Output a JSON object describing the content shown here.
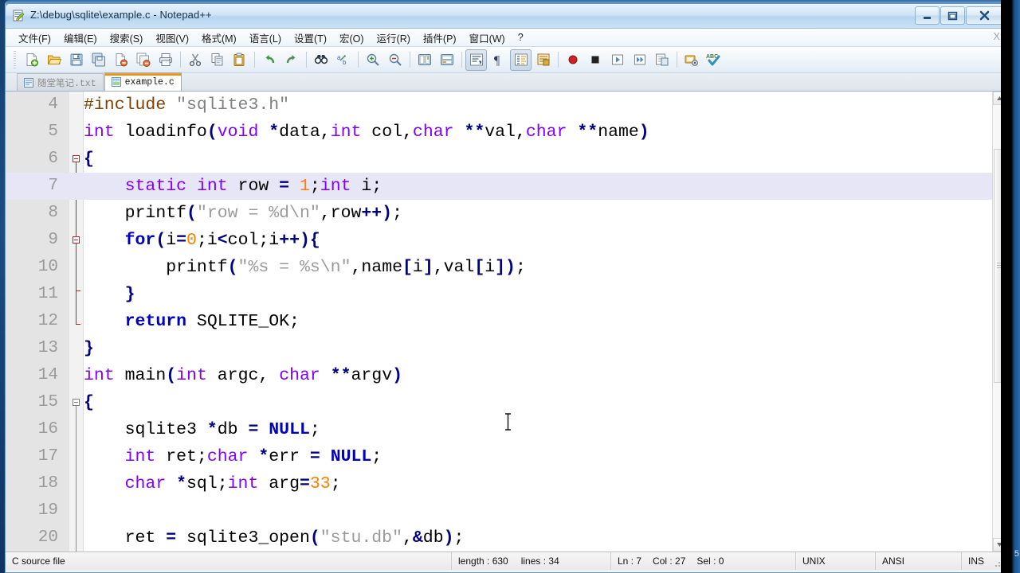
{
  "window": {
    "title": "Z:\\debug\\sqlite\\example.c - Notepad++",
    "minimize_label": "Minimize",
    "restore_label": "Restore",
    "close_label": "Close"
  },
  "menu": {
    "items": [
      {
        "label": "文件(F)",
        "name": "menu-file"
      },
      {
        "label": "编辑(E)",
        "name": "menu-edit"
      },
      {
        "label": "搜索(S)",
        "name": "menu-search"
      },
      {
        "label": "视图(V)",
        "name": "menu-view"
      },
      {
        "label": "格式(M)",
        "name": "menu-format"
      },
      {
        "label": "语言(L)",
        "name": "menu-language"
      },
      {
        "label": "设置(T)",
        "name": "menu-settings"
      },
      {
        "label": "宏(O)",
        "name": "menu-macro"
      },
      {
        "label": "运行(R)",
        "name": "menu-run"
      },
      {
        "label": "插件(P)",
        "name": "menu-plugins"
      },
      {
        "label": "窗口(W)",
        "name": "menu-window"
      },
      {
        "label": "?",
        "name": "menu-help"
      }
    ],
    "close_doc_label": "X"
  },
  "toolbar": {
    "buttons": [
      {
        "name": "new-file-icon",
        "title": "新建"
      },
      {
        "name": "open-file-icon",
        "title": "打开"
      },
      {
        "name": "save-icon",
        "title": "保存"
      },
      {
        "name": "save-all-icon",
        "title": "保存所有"
      },
      {
        "name": "close-file-icon",
        "title": "关闭"
      },
      {
        "name": "close-all-icon",
        "title": "关闭所有"
      },
      {
        "name": "print-icon",
        "title": "打印"
      },
      {
        "sep": true
      },
      {
        "name": "cut-icon",
        "title": "剪切"
      },
      {
        "name": "copy-icon",
        "title": "复制"
      },
      {
        "name": "paste-icon",
        "title": "粘贴"
      },
      {
        "sep": true
      },
      {
        "name": "undo-icon",
        "title": "撤销"
      },
      {
        "name": "redo-icon",
        "title": "重做"
      },
      {
        "sep": true
      },
      {
        "name": "find-icon",
        "title": "查找"
      },
      {
        "name": "replace-icon",
        "title": "替换"
      },
      {
        "sep": true
      },
      {
        "name": "zoom-in-icon",
        "title": "放大"
      },
      {
        "name": "zoom-out-icon",
        "title": "缩小"
      },
      {
        "sep": true
      },
      {
        "name": "sync-scroll-v-icon",
        "title": "同步垂直滚动"
      },
      {
        "name": "sync-scroll-h-icon",
        "title": "同步水平滚动"
      },
      {
        "sep": true
      },
      {
        "name": "word-wrap-icon",
        "title": "自动换行"
      },
      {
        "name": "show-all-chars-icon",
        "title": "显示所有字符"
      },
      {
        "name": "indent-guide-icon",
        "title": "缩进参考线"
      },
      {
        "name": "show-ui-icon",
        "title": "用户自定义语言"
      },
      {
        "sep": true
      },
      {
        "name": "record-macro-icon",
        "title": "开始录制宏"
      },
      {
        "name": "stop-macro-icon",
        "title": "停止录制宏"
      },
      {
        "name": "play-macro-icon",
        "title": "播放宏"
      },
      {
        "name": "run-macro-multiple-icon",
        "title": "多次运行宏"
      },
      {
        "name": "save-macro-icon",
        "title": "保存当前录制的宏"
      },
      {
        "sep": true
      },
      {
        "name": "run-icon",
        "title": "运行"
      },
      {
        "name": "spellcheck-icon",
        "title": "拼写检查"
      }
    ]
  },
  "tabs": [
    {
      "label": "随堂笔记.txt",
      "active": false,
      "icon": "text-file-icon"
    },
    {
      "label": "example.c",
      "active": true,
      "icon": "c-file-icon"
    }
  ],
  "editor": {
    "first_visible_line": 4,
    "current_line": 7,
    "colors": {
      "keyword": "#0000c0",
      "type": "#8000ff",
      "string": "#9b9b9b",
      "number": "#ff8000",
      "operator": "#000080",
      "preprocessor": "#804000",
      "current_line_bg": "#e6e6f7",
      "gutter_bg": "#e4e4e4",
      "line_number": "#9a9a9a"
    },
    "lines": [
      {
        "n": 4,
        "tokens": [
          {
            "t": "#include ",
            "c": "pre"
          },
          {
            "t": "\"sqlite3.h\"",
            "c": "pstr"
          }
        ]
      },
      {
        "n": 5,
        "tokens": [
          {
            "t": "int",
            "c": "typ"
          },
          {
            "t": " loadinfo",
            "c": "plain"
          },
          {
            "t": "(",
            "c": "op"
          },
          {
            "t": "void",
            "c": "typ"
          },
          {
            "t": " ",
            "c": "plain"
          },
          {
            "t": "*",
            "c": "op"
          },
          {
            "t": "data,",
            "c": "plain"
          },
          {
            "t": "int",
            "c": "typ"
          },
          {
            "t": " col,",
            "c": "plain"
          },
          {
            "t": "char",
            "c": "typ"
          },
          {
            "t": " ",
            "c": "plain"
          },
          {
            "t": "**",
            "c": "op"
          },
          {
            "t": "val,",
            "c": "plain"
          },
          {
            "t": "char",
            "c": "typ"
          },
          {
            "t": " ",
            "c": "plain"
          },
          {
            "t": "**",
            "c": "op"
          },
          {
            "t": "name",
            "c": "plain"
          },
          {
            "t": ")",
            "c": "op"
          }
        ]
      },
      {
        "n": 6,
        "tokens": [
          {
            "t": "{",
            "c": "op"
          }
        ]
      },
      {
        "n": 7,
        "tokens": [
          {
            "t": "    ",
            "c": "plain"
          },
          {
            "t": "static",
            "c": "typ"
          },
          {
            "t": " ",
            "c": "plain"
          },
          {
            "t": "int",
            "c": "typ"
          },
          {
            "t": " row ",
            "c": "plain"
          },
          {
            "t": "=",
            "c": "op"
          },
          {
            "t": " ",
            "c": "plain"
          },
          {
            "t": "1",
            "c": "num"
          },
          {
            "t": ";",
            "c": "plain"
          },
          {
            "t": "int",
            "c": "typ"
          },
          {
            "t": " i;",
            "c": "plain"
          }
        ]
      },
      {
        "n": 8,
        "tokens": [
          {
            "t": "    printf",
            "c": "plain"
          },
          {
            "t": "(",
            "c": "op"
          },
          {
            "t": "\"row = %d\\n\"",
            "c": "str"
          },
          {
            "t": ",row",
            "c": "plain"
          },
          {
            "t": "++)",
            "c": "op"
          },
          {
            "t": ";",
            "c": "plain"
          }
        ]
      },
      {
        "n": 9,
        "tokens": [
          {
            "t": "    ",
            "c": "plain"
          },
          {
            "t": "for",
            "c": "kw"
          },
          {
            "t": "(",
            "c": "op"
          },
          {
            "t": "i",
            "c": "plain"
          },
          {
            "t": "=",
            "c": "op"
          },
          {
            "t": "0",
            "c": "num"
          },
          {
            "t": ";i",
            "c": "plain"
          },
          {
            "t": "<",
            "c": "op"
          },
          {
            "t": "col;i",
            "c": "plain"
          },
          {
            "t": "++){",
            "c": "op"
          }
        ]
      },
      {
        "n": 10,
        "tokens": [
          {
            "t": "        printf",
            "c": "plain"
          },
          {
            "t": "(",
            "c": "op"
          },
          {
            "t": "\"%s = %s\\n\"",
            "c": "str"
          },
          {
            "t": ",name",
            "c": "plain"
          },
          {
            "t": "[",
            "c": "op"
          },
          {
            "t": "i",
            "c": "plain"
          },
          {
            "t": "]",
            "c": "op"
          },
          {
            "t": ",val",
            "c": "plain"
          },
          {
            "t": "[",
            "c": "op"
          },
          {
            "t": "i",
            "c": "plain"
          },
          {
            "t": "])",
            "c": "op"
          },
          {
            "t": ";",
            "c": "plain"
          }
        ]
      },
      {
        "n": 11,
        "tokens": [
          {
            "t": "    ",
            "c": "plain"
          },
          {
            "t": "}",
            "c": "op"
          }
        ]
      },
      {
        "n": 12,
        "tokens": [
          {
            "t": "    ",
            "c": "plain"
          },
          {
            "t": "return",
            "c": "kw"
          },
          {
            "t": " SQLITE_OK;",
            "c": "plain"
          }
        ]
      },
      {
        "n": 13,
        "tokens": [
          {
            "t": "}",
            "c": "op"
          }
        ]
      },
      {
        "n": 14,
        "tokens": [
          {
            "t": "int",
            "c": "typ"
          },
          {
            "t": " main",
            "c": "plain"
          },
          {
            "t": "(",
            "c": "op"
          },
          {
            "t": "int",
            "c": "typ"
          },
          {
            "t": " argc, ",
            "c": "plain"
          },
          {
            "t": "char",
            "c": "typ"
          },
          {
            "t": " ",
            "c": "plain"
          },
          {
            "t": "**",
            "c": "op"
          },
          {
            "t": "argv",
            "c": "plain"
          },
          {
            "t": ")",
            "c": "op"
          }
        ]
      },
      {
        "n": 15,
        "tokens": [
          {
            "t": "{",
            "c": "op"
          }
        ]
      },
      {
        "n": 16,
        "tokens": [
          {
            "t": "    sqlite3 ",
            "c": "plain"
          },
          {
            "t": "*",
            "c": "op"
          },
          {
            "t": "db ",
            "c": "plain"
          },
          {
            "t": "=",
            "c": "op"
          },
          {
            "t": " ",
            "c": "plain"
          },
          {
            "t": "NULL",
            "c": "kw"
          },
          {
            "t": ";",
            "c": "plain"
          }
        ]
      },
      {
        "n": 17,
        "tokens": [
          {
            "t": "    ",
            "c": "plain"
          },
          {
            "t": "int",
            "c": "typ"
          },
          {
            "t": " ret;",
            "c": "plain"
          },
          {
            "t": "char",
            "c": "typ"
          },
          {
            "t": " ",
            "c": "plain"
          },
          {
            "t": "*",
            "c": "op"
          },
          {
            "t": "err ",
            "c": "plain"
          },
          {
            "t": "=",
            "c": "op"
          },
          {
            "t": " ",
            "c": "plain"
          },
          {
            "t": "NULL",
            "c": "kw"
          },
          {
            "t": ";",
            "c": "plain"
          }
        ]
      },
      {
        "n": 18,
        "tokens": [
          {
            "t": "    ",
            "c": "plain"
          },
          {
            "t": "char",
            "c": "typ"
          },
          {
            "t": " ",
            "c": "plain"
          },
          {
            "t": "*",
            "c": "op"
          },
          {
            "t": "sql;",
            "c": "plain"
          },
          {
            "t": "int",
            "c": "typ"
          },
          {
            "t": " arg",
            "c": "plain"
          },
          {
            "t": "=",
            "c": "op"
          },
          {
            "t": "33",
            "c": "num"
          },
          {
            "t": ";",
            "c": "plain"
          }
        ]
      },
      {
        "n": 19,
        "tokens": []
      },
      {
        "n": 20,
        "tokens": [
          {
            "t": "    ret ",
            "c": "plain"
          },
          {
            "t": "=",
            "c": "op"
          },
          {
            "t": " sqlite3_open",
            "c": "plain"
          },
          {
            "t": "(",
            "c": "op"
          },
          {
            "t": "\"stu.db\"",
            "c": "str"
          },
          {
            "t": ",",
            "c": "plain"
          },
          {
            "t": "&",
            "c": "op"
          },
          {
            "t": "db",
            "c": "plain"
          },
          {
            "t": ")",
            "c": "op"
          },
          {
            "t": ";",
            "c": "plain"
          }
        ]
      }
    ]
  },
  "statusbar": {
    "doc_type": "C source file",
    "length_label": "length : 630",
    "lines_label": "lines : 34",
    "ln": "Ln : 7",
    "col": "Col : 27",
    "sel": "Sel : 0",
    "eol": "UNIX",
    "encoding": "ANSI",
    "insert_mode": "INS"
  },
  "background": {
    "edge_number": "5"
  }
}
